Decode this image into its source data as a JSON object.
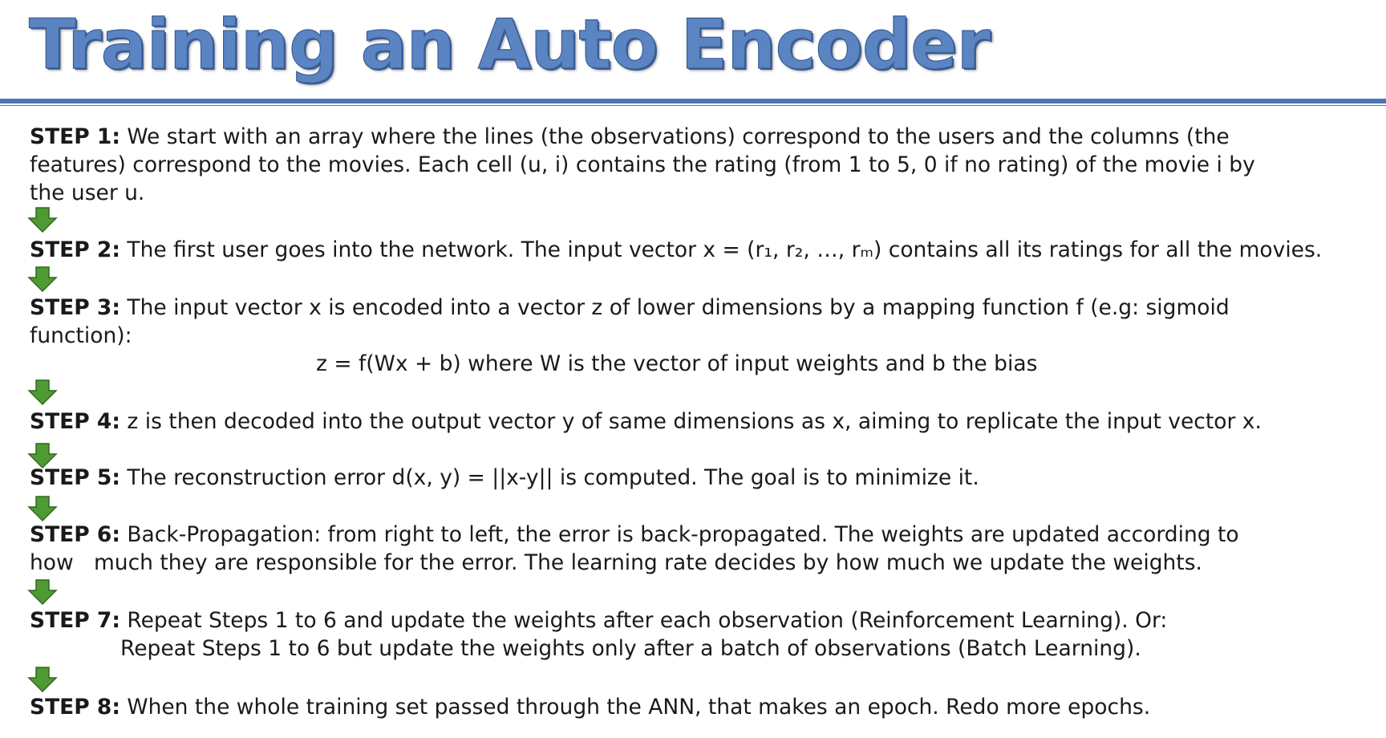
{
  "title": "Training an Auto Encoder",
  "colors": {
    "title": "#5b84c2",
    "rule": "#4b74b4",
    "arrow": "#4e9a33"
  },
  "arrow_icon": "down-arrow-icon",
  "steps": [
    {
      "label": "STEP 1:",
      "lines": [
        " We start with an array where the lines (the observations) correspond to the users and the columns (the",
        "features) correspond to the movies. Each cell (u, i) contains the rating (from 1 to 5, 0 if no rating) of the movie i by",
        "the user u."
      ]
    },
    {
      "label": "STEP 2:",
      "lines": [
        " The first user goes into the network. The input vector x = (r₁, r₂, …, rₘ) contains all its ratings for all the movies."
      ]
    },
    {
      "label": "STEP 3:",
      "lines": [
        " The input vector x is encoded into a vector z of lower dimensions by a mapping function f (e.g: sigmoid",
        "function):"
      ],
      "formula": "z = f(Wx + b) where W is the vector of input weights and b the bias"
    },
    {
      "label": "STEP 4:",
      "lines": [
        " z is then decoded into the output vector y of same dimensions as x, aiming to replicate the input vector x."
      ]
    },
    {
      "label": "STEP 5:",
      "lines": [
        " The reconstruction error d(x, y) = ||x-y|| is computed. The goal is to minimize it."
      ]
    },
    {
      "label": "STEP 6:",
      "lines": [
        " Back-Propagation: from right to left, the error is back-propagated. The weights are updated according to",
        "how   much they are responsible for the error. The learning rate decides by how much we update the weights."
      ]
    },
    {
      "label": "STEP 7:",
      "lines": [
        " Repeat Steps 1 to 6 and update the weights after each observation (Reinforcement Learning). Or:",
        "Repeat Steps 1 to 6 but update the weights only after a batch of observations (Batch Learning)."
      ]
    },
    {
      "label": "STEP 8:",
      "lines": [
        " When the whole training set passed through the ANN, that makes an epoch. Redo more epochs."
      ]
    }
  ]
}
